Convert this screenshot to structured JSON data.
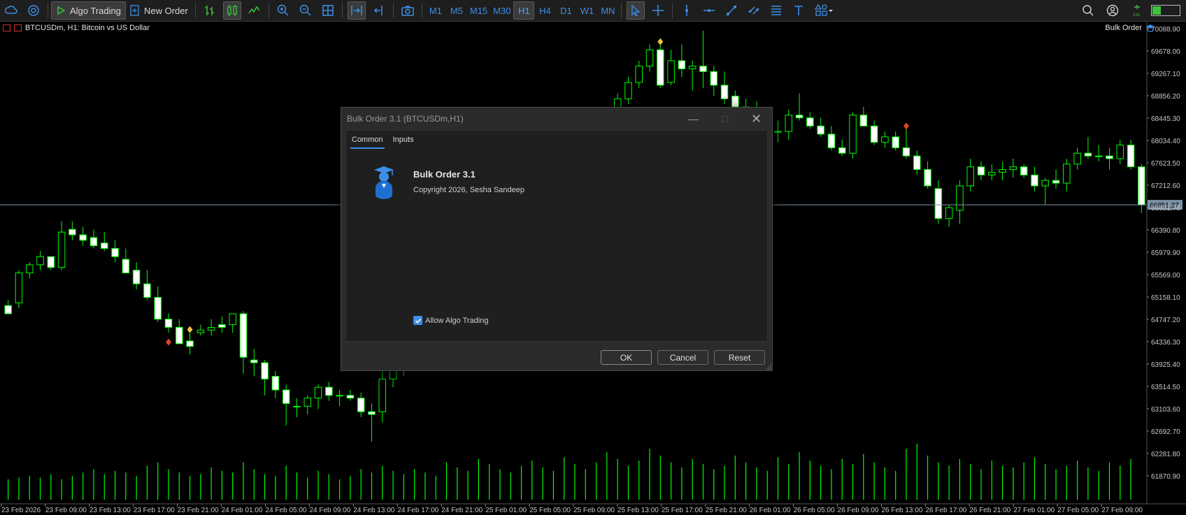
{
  "toolbar": {
    "algo_trading_label": "Algo Trading",
    "new_order_label": "New Order",
    "timeframes": [
      "M1",
      "M5",
      "M15",
      "M30",
      "H1",
      "H4",
      "D1",
      "W1",
      "MN"
    ],
    "active_timeframe": "H1"
  },
  "chart": {
    "symbol_label": "BTCUSDm, H1:  Bitcoin vs US Dollar",
    "ea_label": "Bulk Order",
    "current_price_label": "66851.37",
    "colors": {
      "bull": "#00ff00",
      "bear_fill": "#ffffff",
      "bid_line": "#7b93a8",
      "axis_text": "#c8c8c8"
    }
  },
  "chart_data": {
    "type": "candlestick",
    "price_ticks": [
      "70088.90",
      "69678.00",
      "69267.10",
      "68856.20",
      "68445.30",
      "68034.40",
      "67623.50",
      "67212.60",
      "66801.70",
      "66390.80",
      "65979.90",
      "65569.00",
      "65158.10",
      "64747.20",
      "64336.30",
      "63925.40",
      "63514.50",
      "63103.60",
      "62692.70",
      "62281.80",
      "61870.90"
    ],
    "time_labels": [
      "23 Feb 2026",
      "23 Feb 09:00",
      "23 Feb 13:00",
      "23 Feb 17:00",
      "23 Feb 21:00",
      "24 Feb 01:00",
      "24 Feb 05:00",
      "24 Feb 09:00",
      "24 Feb 13:00",
      "24 Feb 17:00",
      "24 Feb 21:00",
      "25 Feb 01:00",
      "25 Feb 05:00",
      "25 Feb 09:00",
      "25 Feb 13:00",
      "25 Feb 17:00",
      "25 Feb 21:00",
      "26 Feb 01:00",
      "26 Feb 05:00",
      "26 Feb 09:00",
      "26 Feb 13:00",
      "26 Feb 17:00",
      "26 Feb 21:00",
      "27 Feb 01:00",
      "27 Feb 05:00",
      "27 Feb 09:00"
    ],
    "current_price": 66851.37,
    "candles": [
      [
        65000,
        65100,
        64850,
        64850
      ],
      [
        65050,
        65650,
        64950,
        65600
      ],
      [
        65600,
        65800,
        65500,
        65750
      ],
      [
        65750,
        66000,
        65650,
        65900
      ],
      [
        65900,
        65900,
        65650,
        65700
      ],
      [
        65700,
        66550,
        65650,
        66350
      ],
      [
        66400,
        66550,
        66200,
        66300
      ],
      [
        66300,
        66450,
        66100,
        66200
      ],
      [
        66250,
        66400,
        66050,
        66100
      ],
      [
        66150,
        66350,
        66000,
        66050
      ],
      [
        66050,
        66200,
        65800,
        65900
      ],
      [
        65850,
        66050,
        65600,
        65600
      ],
      [
        65650,
        65800,
        65300,
        65400
      ],
      [
        65400,
        65650,
        65100,
        65150
      ],
      [
        65150,
        65350,
        64700,
        64750
      ],
      [
        64750,
        64850,
        64500,
        64600
      ],
      [
        64600,
        64750,
        64300,
        64300
      ],
      [
        64350,
        64550,
        64100,
        64250
      ],
      [
        64500,
        64650,
        64450,
        64550
      ],
      [
        64550,
        64750,
        64450,
        64600
      ],
      [
        64650,
        64800,
        64500,
        64600
      ],
      [
        64650,
        64850,
        64500,
        64850
      ],
      [
        64850,
        64900,
        63750,
        64050
      ],
      [
        64000,
        64200,
        63700,
        63950
      ],
      [
        63950,
        64000,
        63350,
        63650
      ],
      [
        63700,
        63800,
        63300,
        63450
      ],
      [
        63450,
        63550,
        62800,
        63200
      ],
      [
        63150,
        63300,
        62950,
        63150
      ],
      [
        63150,
        63350,
        63000,
        63300
      ],
      [
        63300,
        63550,
        63100,
        63500
      ],
      [
        63500,
        63600,
        63250,
        63350
      ],
      [
        63350,
        63450,
        63150,
        63350
      ],
      [
        63350,
        63450,
        63250,
        63300
      ],
      [
        63300,
        63400,
        62950,
        63050
      ],
      [
        63050,
        63200,
        62500,
        63000
      ],
      [
        63050,
        63800,
        62850,
        63650
      ],
      [
        63650,
        64100,
        63500,
        63900
      ],
      [
        63900,
        64150,
        63700,
        63950
      ],
      [
        63950,
        64200,
        63850,
        64100
      ],
      [
        64100,
        64400,
        63900,
        64300
      ],
      [
        64300,
        64500,
        64150,
        64400
      ],
      [
        64400,
        64600,
        64250,
        64500
      ],
      [
        64500,
        64700,
        64300,
        64600
      ],
      [
        64600,
        64850,
        64450,
        64700
      ],
      [
        64700,
        65000,
        64600,
        64900
      ],
      [
        64900,
        65300,
        64800,
        65200
      ],
      [
        65200,
        65600,
        65100,
        65500
      ],
      [
        65500,
        65900,
        65400,
        65800
      ],
      [
        65800,
        66200,
        65700,
        66100
      ],
      [
        66100,
        66500,
        66000,
        66400
      ],
      [
        66400,
        66800,
        66300,
        66700
      ],
      [
        66700,
        67100,
        66600,
        67000
      ],
      [
        67000,
        67400,
        66900,
        67300
      ],
      [
        67300,
        67700,
        67200,
        67600
      ],
      [
        67600,
        68000,
        67500,
        67900
      ],
      [
        67900,
        68300,
        67800,
        68200
      ],
      [
        68200,
        68600,
        68100,
        68500
      ],
      [
        68500,
        68900,
        68400,
        68800
      ],
      [
        68800,
        69200,
        68700,
        69100
      ],
      [
        69100,
        69500,
        69000,
        69400
      ],
      [
        69400,
        69800,
        69300,
        69700
      ],
      [
        69700,
        69900,
        69000,
        69050
      ],
      [
        69100,
        69700,
        69050,
        69500
      ],
      [
        69500,
        69800,
        69200,
        69350
      ],
      [
        69350,
        69500,
        68950,
        69400
      ],
      [
        69400,
        70050,
        69000,
        69300
      ],
      [
        69300,
        69400,
        68850,
        69050
      ],
      [
        69050,
        69300,
        68700,
        68800
      ],
      [
        68850,
        68950,
        68500,
        68650
      ],
      [
        68650,
        68800,
        68450,
        68600
      ],
      [
        68600,
        68750,
        68300,
        68450
      ],
      [
        68450,
        68600,
        68050,
        68200
      ],
      [
        68200,
        68400,
        68000,
        68200
      ],
      [
        68200,
        68600,
        68050,
        68500
      ],
      [
        68500,
        68900,
        68400,
        68450
      ],
      [
        68450,
        68550,
        68250,
        68300
      ],
      [
        68300,
        68450,
        68100,
        68150
      ],
      [
        68150,
        68300,
        67850,
        67900
      ],
      [
        67900,
        68050,
        67750,
        67800
      ],
      [
        67800,
        68550,
        67700,
        68500
      ],
      [
        68500,
        68650,
        68300,
        68300
      ],
      [
        68300,
        68400,
        67950,
        68000
      ],
      [
        68000,
        68200,
        67900,
        68100
      ],
      [
        68100,
        68200,
        67850,
        67900
      ],
      [
        67900,
        68250,
        67700,
        67750
      ],
      [
        67750,
        67850,
        67400,
        67500
      ],
      [
        67500,
        67650,
        67150,
        67200
      ],
      [
        67150,
        67300,
        66500,
        66600
      ],
      [
        66600,
        66850,
        66450,
        66800
      ],
      [
        66750,
        67300,
        66500,
        67200
      ],
      [
        67200,
        67700,
        67100,
        67550
      ],
      [
        67550,
        67650,
        67300,
        67400
      ],
      [
        67400,
        67600,
        67300,
        67450
      ],
      [
        67450,
        67650,
        67300,
        67500
      ],
      [
        67500,
        67700,
        67350,
        67550
      ],
      [
        67550,
        67600,
        67350,
        67400
      ],
      [
        67400,
        67550,
        67100,
        67200
      ],
      [
        67200,
        67350,
        66850,
        67300
      ],
      [
        67300,
        67500,
        67150,
        67250
      ],
      [
        67250,
        67700,
        67100,
        67600
      ],
      [
        67600,
        67900,
        67500,
        67800
      ],
      [
        67800,
        68100,
        67700,
        67750
      ],
      [
        67750,
        67950,
        67650,
        67750
      ],
      [
        67750,
        67900,
        67500,
        67700
      ],
      [
        67700,
        68050,
        67600,
        67950
      ],
      [
        67950,
        68050,
        67500,
        67550
      ],
      [
        67550,
        67600,
        66700,
        66850
      ]
    ],
    "volumes": [
      12,
      13,
      14,
      13,
      15,
      12,
      14,
      16,
      18,
      15,
      17,
      16,
      14,
      20,
      22,
      18,
      16,
      14,
      15,
      19,
      17,
      16,
      22,
      18,
      15,
      14,
      20,
      16,
      13,
      17,
      15,
      12,
      14,
      18,
      16,
      20,
      17,
      15,
      18,
      16,
      14,
      22,
      19,
      17,
      24,
      21,
      18,
      16,
      20,
      23,
      19,
      17,
      25,
      21,
      18,
      22,
      28,
      24,
      20,
      23,
      30,
      26,
      22,
      19,
      24,
      21,
      18,
      20,
      26,
      22,
      19,
      17,
      25,
      21,
      28,
      23,
      20,
      18,
      24,
      21,
      27,
      22,
      19,
      17,
      30,
      33,
      26,
      22,
      20,
      24,
      21,
      18,
      23,
      20,
      19,
      22,
      25,
      21,
      18,
      20,
      23,
      19,
      17,
      22,
      20,
      24
    ]
  },
  "dialog": {
    "title": "Bulk Order 3.1 (BTCUSDm,H1)",
    "tabs": [
      "Common",
      "Inputs"
    ],
    "app_name": "Bulk Order 3.1",
    "copyright": "Copyright 2026, Sesha Sandeep",
    "allow_algo_label": "Allow Algo Trading",
    "allow_algo_checked": true,
    "ok_label": "OK",
    "cancel_label": "Cancel",
    "reset_label": "Reset"
  }
}
